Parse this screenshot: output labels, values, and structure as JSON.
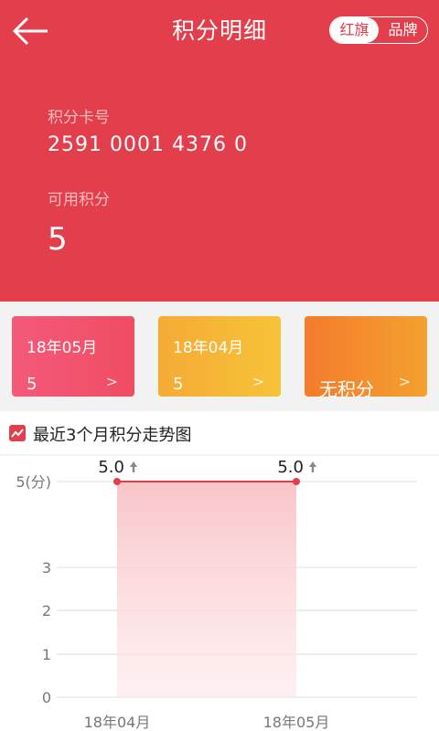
{
  "header": {
    "title": "积分明细",
    "toggle": [
      "红旗",
      "品牌"
    ],
    "card_label": "积分卡号",
    "card_number": "2591  0001  4376  0",
    "points_label": "可用积分",
    "points_value": "5"
  },
  "months": [
    {
      "date": "18年05月",
      "value": "5"
    },
    {
      "date": "18年04月",
      "value": "5"
    },
    {
      "label": "无积分"
    }
  ],
  "trend": {
    "title": "最近3个月积分走势图"
  },
  "chart_data": {
    "type": "area",
    "categories": [
      "18年04月",
      "18年05月"
    ],
    "values": [
      5.0,
      5.0
    ],
    "point_labels": [
      "5.0",
      "5.0"
    ],
    "y_ticks": [
      "0",
      "1",
      "2",
      "3",
      "5(分)"
    ],
    "ylim": [
      0,
      5
    ],
    "colors": {
      "line": "#e23e4c",
      "fill": "#f9c5c9"
    }
  }
}
